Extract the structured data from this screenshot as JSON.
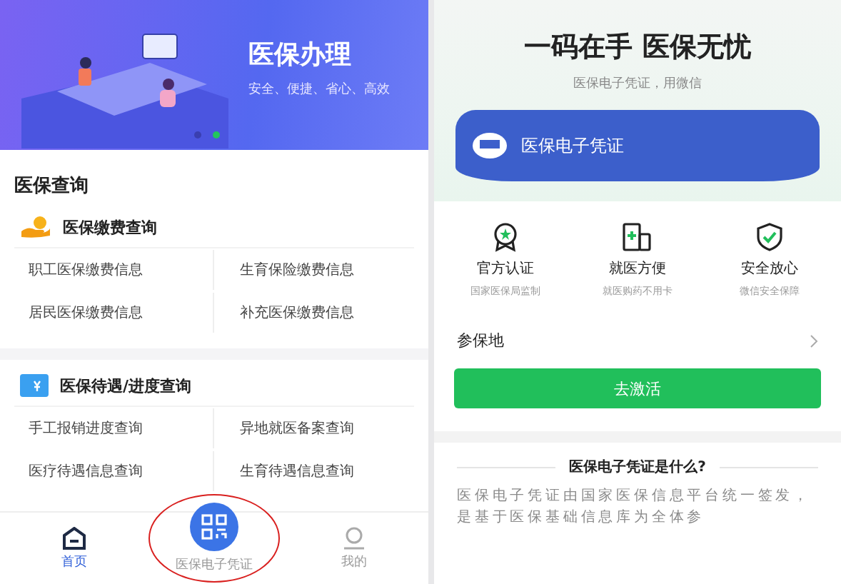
{
  "left_screen": {
    "banner": {
      "title": "医保办理",
      "subtitle": "安全、便捷、省心、高效",
      "dots": [
        {
          "selected": false
        },
        {
          "selected": true
        }
      ]
    },
    "section_title": "医保查询",
    "groups": [
      {
        "kind": "coin",
        "title": "医保缴费查询",
        "items": [
          "职工医保缴费信息",
          "生育保险缴费信息",
          "居民医保缴费信息",
          "补充医保缴费信息"
        ]
      },
      {
        "kind": "ticket",
        "title": "医保待遇/进度查询",
        "items": [
          "手工报销进度查询",
          "异地就医备案查询",
          "医疗待遇信息查询",
          "生育待遇信息查询"
        ]
      }
    ],
    "tab_bar": [
      {
        "kind": "home",
        "label": "首页",
        "selected": true
      },
      {
        "kind": "qr",
        "label": "医保电子凭证",
        "selected": false
      },
      {
        "kind": "profile",
        "label": "我的",
        "selected": false
      }
    ]
  },
  "right_screen": {
    "headline": "一码在手 医保无忧",
    "subheadline": "医保电子凭证，用微信",
    "card": {
      "title": "医保电子凭证"
    },
    "features": [
      {
        "kind": "badge",
        "title": "官方认证",
        "caption": "国家医保局监制"
      },
      {
        "kind": "clinic",
        "title": "就医方便",
        "caption": "就医购药不用卡"
      },
      {
        "kind": "shield",
        "title": "安全放心",
        "caption": "微信安全保障"
      }
    ],
    "insured_place": {
      "label": "参保地"
    },
    "activate_button": "去激活",
    "faq_heading": "医保电子凭证是什么?",
    "faq_text": "医保电子凭证由国家医保信息平台统一签发，是基于医保基础信息库为全体参"
  }
}
